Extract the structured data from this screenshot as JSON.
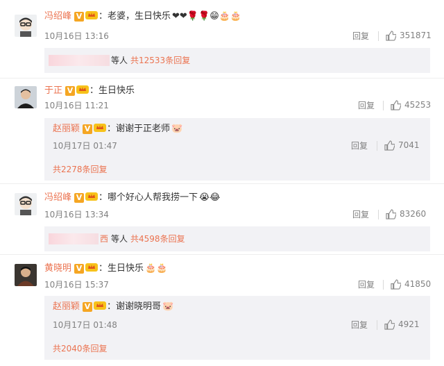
{
  "comments": [
    {
      "user": "冯绍峰",
      "text": "：老婆，生日快乐",
      "emoji": "❤❤🌹🌹😁🎂🎂",
      "time": "10月16日 13:16",
      "reply": "回复",
      "likes": "351871",
      "summary": {
        "tail": "等人",
        "count": "共12533条回复"
      }
    },
    {
      "user": "于正",
      "text": "：生日快乐",
      "time": "10月16日 11:21",
      "reply": "回复",
      "likes": "45253",
      "sub": {
        "user": "赵丽颖",
        "text": "：谢谢于正老师",
        "emoji": "🐷",
        "time": "10月17日 01:47",
        "reply": "回复",
        "likes": "7041"
      },
      "total": "共2278条回复"
    },
    {
      "user": "冯绍峰",
      "text": "：哪个好心人帮我捞一下",
      "emoji": "😭😂",
      "time": "10月16日 13:34",
      "reply": "回复",
      "likes": "83260",
      "summary": {
        "tail": "等人",
        "count": "共4598条回复",
        "partial": "西"
      }
    },
    {
      "user": "黄晓明",
      "text": "：生日快乐",
      "emoji": "🎂🎂",
      "time": "10月16日 15:37",
      "reply": "回复",
      "likes": "41850",
      "sub": {
        "user": "赵丽颖",
        "text": "：谢谢晓明哥",
        "emoji": "🐷",
        "time": "10月17日 01:48",
        "reply": "回复",
        "likes": "4921"
      },
      "total": "共2040条回复"
    }
  ],
  "icons": {
    "verified": "V",
    "crown": "crown-icon",
    "like": "thumbs-up-icon"
  },
  "colors": {
    "username": "#eb7350",
    "meta": "#808080",
    "reply_bg": "#f2f2f5",
    "badge": "#f5a623"
  }
}
